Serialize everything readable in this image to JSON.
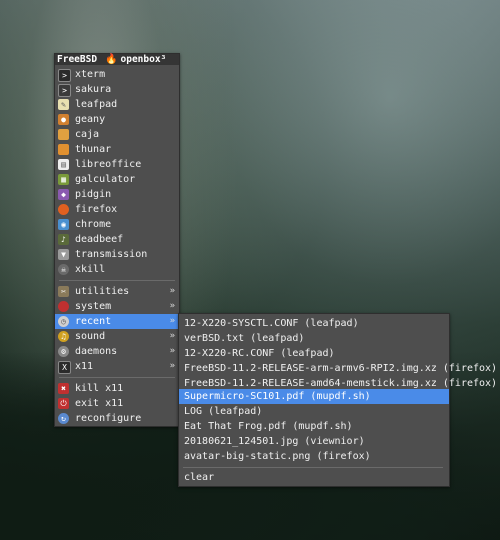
{
  "menu": {
    "title_left": "FreeBSD",
    "title_right": "openbox³",
    "items": [
      {
        "label": "xterm",
        "icon": "terminal-icon",
        "color": "#2b2b2b"
      },
      {
        "label": "sakura",
        "icon": "terminal-icon",
        "color": "#3a3a3a"
      },
      {
        "label": "leafpad",
        "icon": "notepad-icon",
        "color": "#e8e0b0"
      },
      {
        "label": "geany",
        "icon": "geany-icon",
        "color": "#d08030"
      },
      {
        "label": "caja",
        "icon": "folder-icon",
        "color": "#e0a040"
      },
      {
        "label": "thunar",
        "icon": "folder-icon",
        "color": "#e09030"
      },
      {
        "label": "libreoffice",
        "icon": "document-icon",
        "color": "#eeeeee"
      },
      {
        "label": "galculator",
        "icon": "calculator-icon",
        "color": "#7a9a3a"
      },
      {
        "label": "pidgin",
        "icon": "pidgin-icon",
        "color": "#8a5ab0"
      },
      {
        "label": "firefox",
        "icon": "firefox-icon",
        "color": "#e06020"
      },
      {
        "label": "chrome",
        "icon": "chrome-icon",
        "color": "#4a90d0"
      },
      {
        "label": "deadbeef",
        "icon": "music-player-icon",
        "color": "#5a6a3a"
      },
      {
        "label": "transmission",
        "icon": "transmission-icon",
        "color": "#9a9a9a"
      },
      {
        "label": "xkill",
        "icon": "skull-icon",
        "color": "#6a6a6a"
      }
    ],
    "submenus": [
      {
        "label": "utilities",
        "icon": "tools-icon",
        "color": "#8a7a5a"
      },
      {
        "label": "system",
        "icon": "system-icon",
        "color": "#c03030"
      },
      {
        "label": "recent",
        "icon": "clock-icon",
        "color": "#d0d0d0"
      },
      {
        "label": "sound",
        "icon": "sound-icon",
        "color": "#d0a020"
      },
      {
        "label": "daemons",
        "icon": "gear-icon",
        "color": "#8a8a8a"
      },
      {
        "label": "x11",
        "icon": "x11-icon",
        "color": "#2b2b2b"
      }
    ],
    "actions": [
      {
        "label": "kill x11",
        "icon": "kill-icon",
        "color": "#c03030"
      },
      {
        "label": "exit x11",
        "icon": "exit-icon",
        "color": "#c03030"
      },
      {
        "label": "reconfigure",
        "icon": "reconfigure-icon",
        "color": "#5a8ad0"
      }
    ],
    "arrow": "»"
  },
  "recent": {
    "items": [
      "12-X220-SYSCTL.CONF (leafpad)",
      "verBSD.txt (leafpad)",
      "12-X220-RC.CONF (leafpad)",
      "FreeBSD-11.2-RELEASE-arm-armv6-RPI2.img.xz (firefox)",
      "FreeBSD-11.2-RELEASE-amd64-memstick.img.xz (firefox)",
      "Supermicro-SC101.pdf (mupdf.sh)",
      "LOG (leafpad)",
      "Eat That Frog.pdf (mupdf.sh)",
      "20180621_124501.jpg (viewnior)",
      "avatar-big-static.png (firefox)"
    ],
    "clear_label": "clear"
  }
}
